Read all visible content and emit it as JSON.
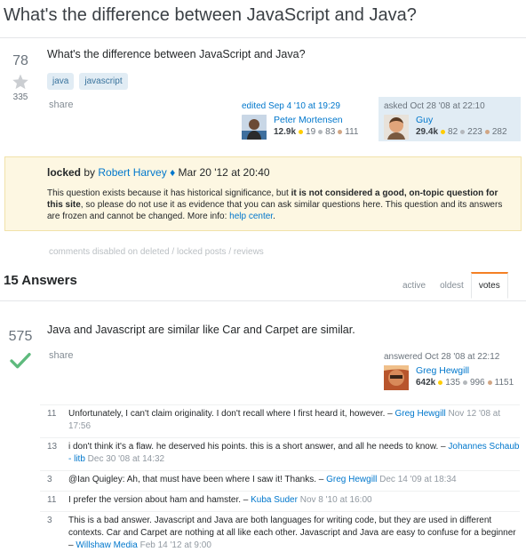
{
  "question": {
    "title": "What's the difference between JavaScript and Java?",
    "body": "What's the difference between JavaScript and Java?",
    "votes": "78",
    "favorites": "335",
    "tags": [
      "java",
      "javascript"
    ],
    "share": "share",
    "edited": {
      "action": "edited Sep 4 '10 at 19:29",
      "user": "Peter Mortensen",
      "rep": "12.9k",
      "gold": "19",
      "silver": "83",
      "bronze": "111"
    },
    "asked": {
      "action": "asked Oct 28 '08 at 22:10",
      "user": "Guy",
      "rep": "29.4k",
      "gold": "82",
      "silver": "223",
      "bronze": "282"
    }
  },
  "notice": {
    "locked": "locked",
    "by": " by ",
    "moderator": "Robert Harvey",
    "diamond": " ♦",
    "date": " Mar 20 '12 at 20:40",
    "text_a": "This question exists because it has historical significance, but ",
    "text_bold": "it is not considered a good, on-topic question for this site",
    "text_b": ", so please do not use it as evidence that you can ask similar questions here. This question and its answers are frozen and cannot be changed. More info: ",
    "help_link": "help center",
    "text_end": "."
  },
  "comments_disabled": "comments disabled on deleted / locked posts / reviews",
  "answers": {
    "count_label": "15 Answers",
    "tabs": [
      "active",
      "oldest",
      "votes"
    ],
    "active_tab": "votes"
  },
  "answer": {
    "votes": "575",
    "body": "Java and Javascript are similar like Car and Carpet are similar.",
    "share": "share",
    "answered": {
      "action": "answered Oct 28 '08 at 22:12",
      "user": "Greg Hewgill",
      "rep": "642k",
      "gold": "135",
      "silver": "996",
      "bronze": "1151"
    },
    "comments": [
      {
        "score": "11",
        "text": "Unfortunately, I can't claim originality. I don't recall where I first heard it, however. – ",
        "user": "Greg Hewgill",
        "date": " Nov 12 '08 at 17:56"
      },
      {
        "score": "13",
        "text": "i don't think it's a flaw. he deserved his points. this is a short answer, and all he needs to know. – ",
        "user": "Johannes Schaub - litb",
        "date": " Dec 30 '08 at 14:32"
      },
      {
        "score": "3",
        "text": "@Ian Quigley: Ah, that must have been where I saw it! Thanks. – ",
        "user": "Greg Hewgill",
        "date": " Dec 14 '09 at 18:34"
      },
      {
        "score": "11",
        "text": "I prefer the version about ham and hamster. – ",
        "user": "Kuba Suder",
        "date": " Nov 8 '10 at 16:00"
      },
      {
        "score": "3",
        "text": "This is a bad answer. Javascript and Java are both languages for writing code, but they are used in different contexts. Car and Carpet are nothing at all like each other. Javascript and Java are easy to confuse for a beginner – ",
        "user": "Willshaw Media",
        "date": " Feb 14 '12 at 9:00"
      }
    ]
  },
  "colors": {
    "link": "#0077cc",
    "accepted": "#5eba7d",
    "notice_bg": "#fdf7e2",
    "owner_bg": "#e1ecf4",
    "tab_accent": "#f48024"
  }
}
